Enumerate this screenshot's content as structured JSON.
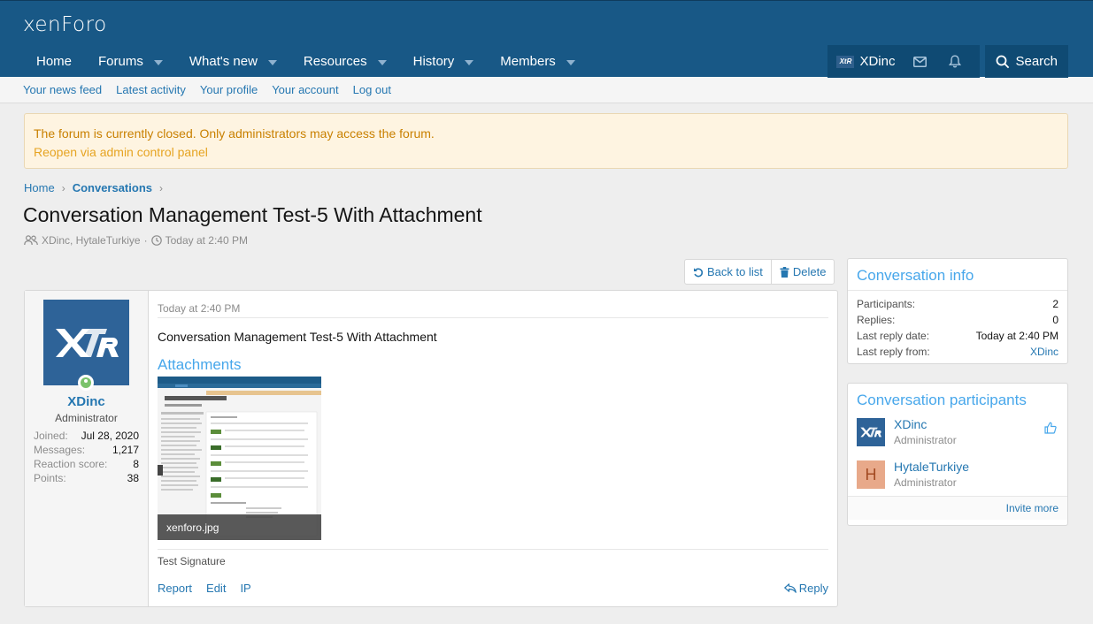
{
  "brand": {
    "logo_text": "xenForo"
  },
  "nav": {
    "items": [
      {
        "label": "Home",
        "has_menu": false
      },
      {
        "label": "Forums",
        "has_menu": true
      },
      {
        "label": "What's new",
        "has_menu": true
      },
      {
        "label": "Resources",
        "has_menu": true
      },
      {
        "label": "History",
        "has_menu": true
      },
      {
        "label": "Members",
        "has_menu": true
      }
    ],
    "account_name": "XDinc",
    "search_label": "Search"
  },
  "subnav": [
    "Your news feed",
    "Latest activity",
    "Your profile",
    "Your account",
    "Log out"
  ],
  "notice": {
    "text": "The forum is currently closed. Only administrators may access the forum.",
    "link": "Reopen via admin control panel"
  },
  "breadcrumb": {
    "home": "Home",
    "current": "Conversations"
  },
  "page": {
    "title": "Conversation Management Test-5 With Attachment",
    "participants": "XDinc, HytaleTurkiye",
    "separator": "·",
    "date": "Today at 2:40 PM"
  },
  "buttons": {
    "back": "Back to list",
    "delete": "Delete"
  },
  "message": {
    "user": {
      "name": "XDinc",
      "title": "Administrator",
      "stats": [
        {
          "label": "Joined:",
          "value": "Jul 28, 2020"
        },
        {
          "label": "Messages:",
          "value": "1,217"
        },
        {
          "label": "Reaction score:",
          "value": "8"
        },
        {
          "label": "Points:",
          "value": "38"
        }
      ]
    },
    "date": "Today at 2:40 PM",
    "body": "Conversation Management Test-5 With Attachment",
    "attachments_heading": "Attachments",
    "attachment_name": "xenforo.jpg",
    "signature": "Test Signature",
    "actions": [
      "Report",
      "Edit",
      "IP"
    ],
    "reply": "Reply"
  },
  "conversation_info": {
    "heading": "Conversation info",
    "rows": [
      {
        "label": "Participants:",
        "value": "2"
      },
      {
        "label": "Replies:",
        "value": "0"
      },
      {
        "label": "Last reply date:",
        "value": "Today at 2:40 PM"
      },
      {
        "label": "Last reply from:",
        "value": "XDinc"
      }
    ]
  },
  "participants_block": {
    "heading": "Conversation participants",
    "list": [
      {
        "name": "XDinc",
        "title": "Administrator"
      },
      {
        "name": "HytaleTurkiye",
        "title": "Administrator",
        "initial": "H"
      }
    ],
    "invite": "Invite more"
  },
  "colors": {
    "header": "#185886",
    "link": "#2577b1",
    "accent": "#47a7eb",
    "notice_bg": "#fef4e1",
    "notice_text": "#c98000",
    "online": "#7bc36c"
  }
}
